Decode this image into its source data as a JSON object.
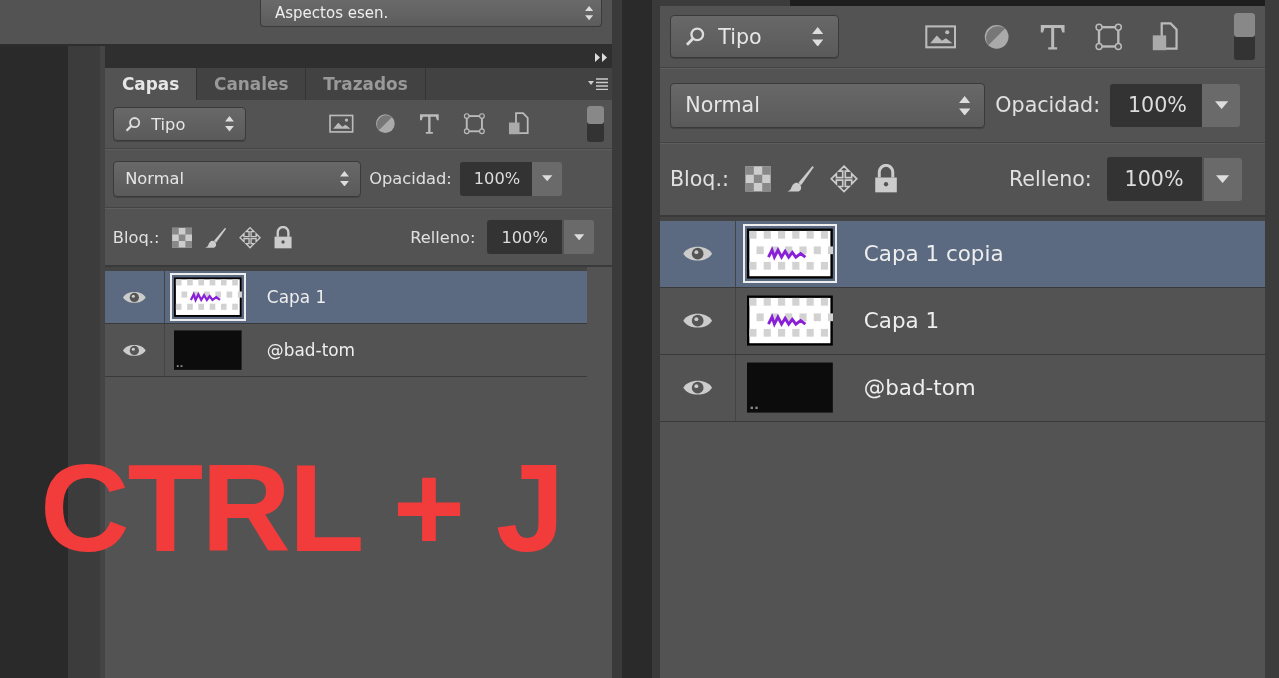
{
  "workspace": {
    "value": "Aspectos esen."
  },
  "panels": [
    {
      "tabs": [
        {
          "label": "Capas",
          "selected": true
        },
        {
          "label": "Canales",
          "selected": false
        },
        {
          "label": "Trazados",
          "selected": false
        }
      ],
      "filter": {
        "value": "Tipo"
      },
      "blend_mode": {
        "value": "Normal"
      },
      "opacity": {
        "label": "Opacidad:",
        "value": "100%"
      },
      "lock_label": "Bloq.:",
      "fill": {
        "label": "Relleno:",
        "value": "100%"
      },
      "layers": [
        {
          "name": "Capa 1",
          "selected": true,
          "kind": "artwork"
        },
        {
          "name": "@bad-tom",
          "selected": false,
          "kind": "black"
        }
      ]
    },
    {
      "filter": {
        "value": "Tipo"
      },
      "blend_mode": {
        "value": "Normal"
      },
      "opacity": {
        "label": "Opacidad:",
        "value": "100%"
      },
      "lock_label": "Bloq.:",
      "fill": {
        "label": "Relleno:",
        "value": "100%"
      },
      "layers": [
        {
          "name": "Capa 1 copia",
          "selected": true,
          "kind": "artwork"
        },
        {
          "name": "Capa 1",
          "selected": false,
          "kind": "artwork"
        },
        {
          "name": "@bad-tom",
          "selected": false,
          "kind": "black"
        }
      ]
    }
  ],
  "overlay": {
    "text": "CTRL + J"
  }
}
